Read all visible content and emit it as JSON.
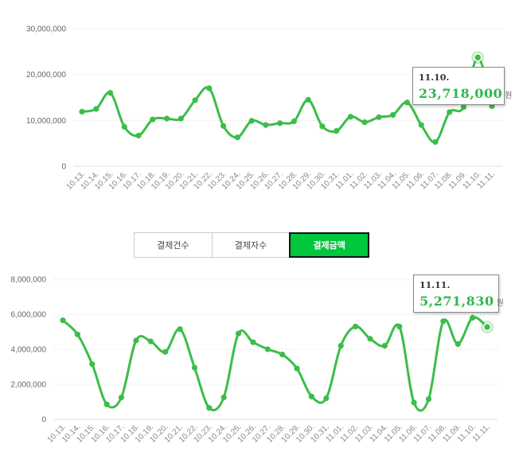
{
  "tabs": [
    {
      "label": "결제건수",
      "active": false
    },
    {
      "label": "결제자수",
      "active": false
    },
    {
      "label": "결제금액",
      "active": true
    }
  ],
  "colors": {
    "line": "#3cbd4a",
    "accent": "#00c73c"
  },
  "chart_data": [
    {
      "type": "line",
      "categories": [
        "10.13.",
        "10.14.",
        "10.15.",
        "10.16.",
        "10.17.",
        "10.18.",
        "10.19.",
        "10.20.",
        "10.21.",
        "10.22.",
        "10.23.",
        "10.24.",
        "10.25.",
        "10.26.",
        "10.27.",
        "10.28.",
        "10.29.",
        "10.30.",
        "10.31.",
        "11.01.",
        "11.02.",
        "11.03.",
        "11.04.",
        "11.05.",
        "11.06.",
        "11.07.",
        "11.08.",
        "11.09.",
        "11.10.",
        "11.11."
      ],
      "values": [
        11900000,
        12500000,
        16000000,
        8600000,
        6700000,
        10200000,
        10400000,
        10400000,
        14400000,
        17000000,
        8800000,
        6300000,
        9900000,
        9000000,
        9400000,
        9800000,
        14500000,
        8700000,
        7700000,
        10800000,
        9600000,
        10700000,
        11200000,
        13900000,
        9000000,
        5300000,
        11800000,
        12900000,
        23718000,
        13100000
      ],
      "yticks": [
        "30,000,000",
        "20,000,000",
        "10,000,000",
        "0"
      ],
      "ylim": [
        0,
        30000000
      ],
      "highlight": {
        "date": "11.10.",
        "value": "23,718,000",
        "unit": "원"
      }
    },
    {
      "type": "line",
      "categories": [
        "10.13.",
        "10.14.",
        "10.15.",
        "10.16.",
        "10.17.",
        "10.18.",
        "10.19.",
        "10.20.",
        "10.21.",
        "10.22.",
        "10.23.",
        "10.24.",
        "10.25.",
        "10.26.",
        "10.27.",
        "10.28.",
        "10.29.",
        "10.30.",
        "10.31.",
        "11.01.",
        "11.02.",
        "11.03.",
        "11.04.",
        "11.05.",
        "11.06.",
        "11.07.",
        "11.08.",
        "11.09.",
        "11.10.",
        "11.11."
      ],
      "values": [
        5650000,
        4850000,
        3150000,
        850000,
        1250000,
        4500000,
        4450000,
        3850000,
        5150000,
        2950000,
        650000,
        1250000,
        4900000,
        4400000,
        4000000,
        3700000,
        2900000,
        1300000,
        1200000,
        4200000,
        5300000,
        4600000,
        4200000,
        5300000,
        950000,
        1150000,
        5600000,
        4300000,
        5800000,
        5271830
      ],
      "yticks": [
        "8,000,000",
        "6,000,000",
        "4,000,000",
        "2,000,000",
        "0"
      ],
      "ylim": [
        0,
        8000000
      ],
      "highlight": {
        "date": "11.11.",
        "value": "5,271,830",
        "unit": "원"
      }
    }
  ]
}
